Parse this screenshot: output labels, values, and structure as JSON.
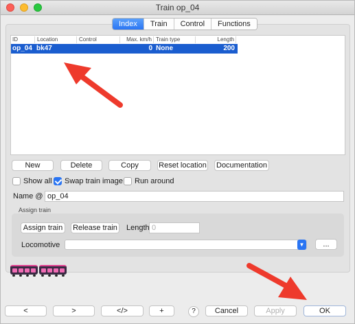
{
  "window": {
    "title": "Train op_04"
  },
  "tabs": [
    {
      "label": "Index",
      "active": true
    },
    {
      "label": "Train",
      "active": false
    },
    {
      "label": "Control",
      "active": false
    },
    {
      "label": "Functions",
      "active": false
    }
  ],
  "table": {
    "headers": [
      "ID",
      "Location",
      "Control",
      "Max. km/h",
      "Train type",
      "Length"
    ],
    "rows": [
      {
        "id": "op_04",
        "location": "bk47",
        "control": "",
        "max_kmh": "0",
        "train_type": "None",
        "length": "200"
      }
    ]
  },
  "actions": {
    "new": "New",
    "delete": "Delete",
    "copy": "Copy",
    "reset_location": "Reset location",
    "documentation": "Documentation"
  },
  "options": {
    "show_all": {
      "label": "Show all",
      "checked": false
    },
    "swap_image": {
      "label": "Swap train image",
      "checked": true
    },
    "run_around": {
      "label": "Run around",
      "checked": false
    }
  },
  "name_field": {
    "label": "Name @",
    "value": "op_04"
  },
  "assign": {
    "title": "Assign train",
    "assign_button": "Assign train",
    "release_button": "Release train",
    "length_label": "Length",
    "length_placeholder": "0",
    "locomotive_label": "Locomotive",
    "locomotive_value": "",
    "more_button": "..."
  },
  "footer": {
    "prev": "<",
    "next": ">",
    "code": "</>",
    "add": "+",
    "help": "?",
    "cancel": "Cancel",
    "apply": "Apply",
    "ok": "OK"
  },
  "icons": {
    "train_images": [
      "train-image-icon",
      "train-image-icon"
    ]
  },
  "colors": {
    "accent": "#2a75f3",
    "selection": "#1a5dcf",
    "annotation_arrow": "#ee3a2c"
  }
}
